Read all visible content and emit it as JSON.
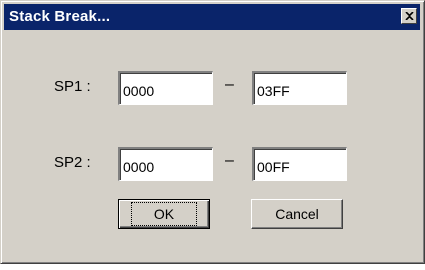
{
  "window": {
    "title": "Stack Break...",
    "close_icon": "close-x-icon"
  },
  "sp1": {
    "label": "SP1 :",
    "start": "0000",
    "separator": "–",
    "end": "03FF"
  },
  "sp2": {
    "label": "SP2 :",
    "start": "0000",
    "separator": "–",
    "end": "00FF"
  },
  "buttons": {
    "ok": "OK",
    "cancel": "Cancel"
  },
  "colors": {
    "titlebar": "#0a246a",
    "face": "#d4d0c8"
  }
}
